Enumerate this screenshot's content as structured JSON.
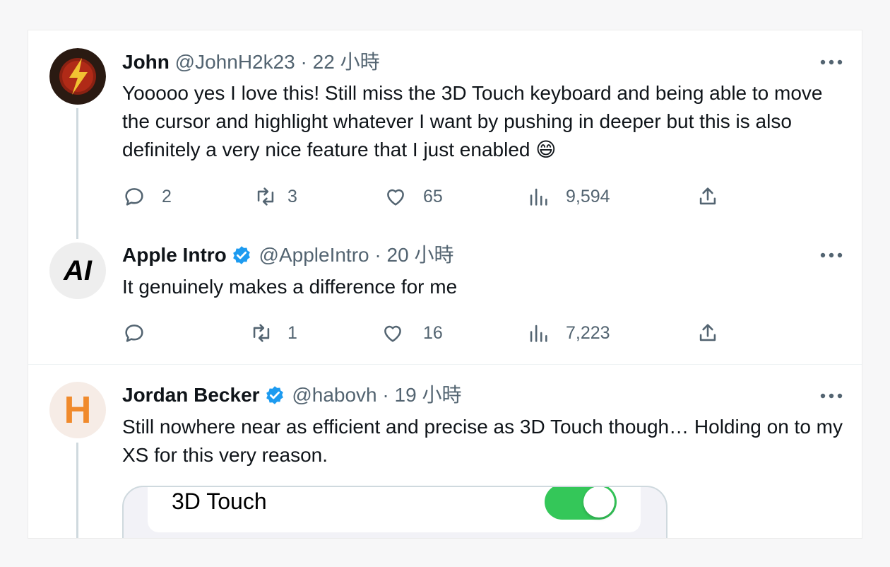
{
  "tweets": [
    {
      "name": "John",
      "handle": "@JohnH2k23",
      "separator": "·",
      "time": "22 小時",
      "verified": false,
      "text": "Yooooo yes I love this! Still miss the 3D Touch keyboard and being able to move the cursor and highlight whatever I want by pushing in deeper but this is also definitely a very nice feature that I just enabled 😄",
      "replies": "2",
      "retweets": "3",
      "likes": "65",
      "views": "9,594"
    },
    {
      "name": "Apple Intro",
      "handle": "@AppleIntro",
      "separator": "·",
      "time": "20 小時",
      "verified": true,
      "avatar_text": "AI",
      "text": "It genuinely makes a difference for me",
      "replies": "",
      "retweets": "1",
      "likes": "16",
      "views": "7,223"
    },
    {
      "name": "Jordan Becker",
      "handle": "@habovh",
      "separator": "·",
      "time": "19 小時",
      "verified": true,
      "avatar_text": "H",
      "text": "Still nowhere near as efficient and precise as 3D Touch though… Holding on to my XS for this very reason.",
      "media": {
        "setting_label": "3D Touch",
        "toggle_on": true
      }
    }
  ],
  "colors": {
    "verified": "#1d9bf0",
    "toggle_on": "#34c759",
    "secondary_text": "#536471"
  },
  "icons": [
    "reply-icon",
    "retweet-icon",
    "like-icon",
    "views-icon",
    "share-icon",
    "more-icon",
    "verified-icon"
  ]
}
